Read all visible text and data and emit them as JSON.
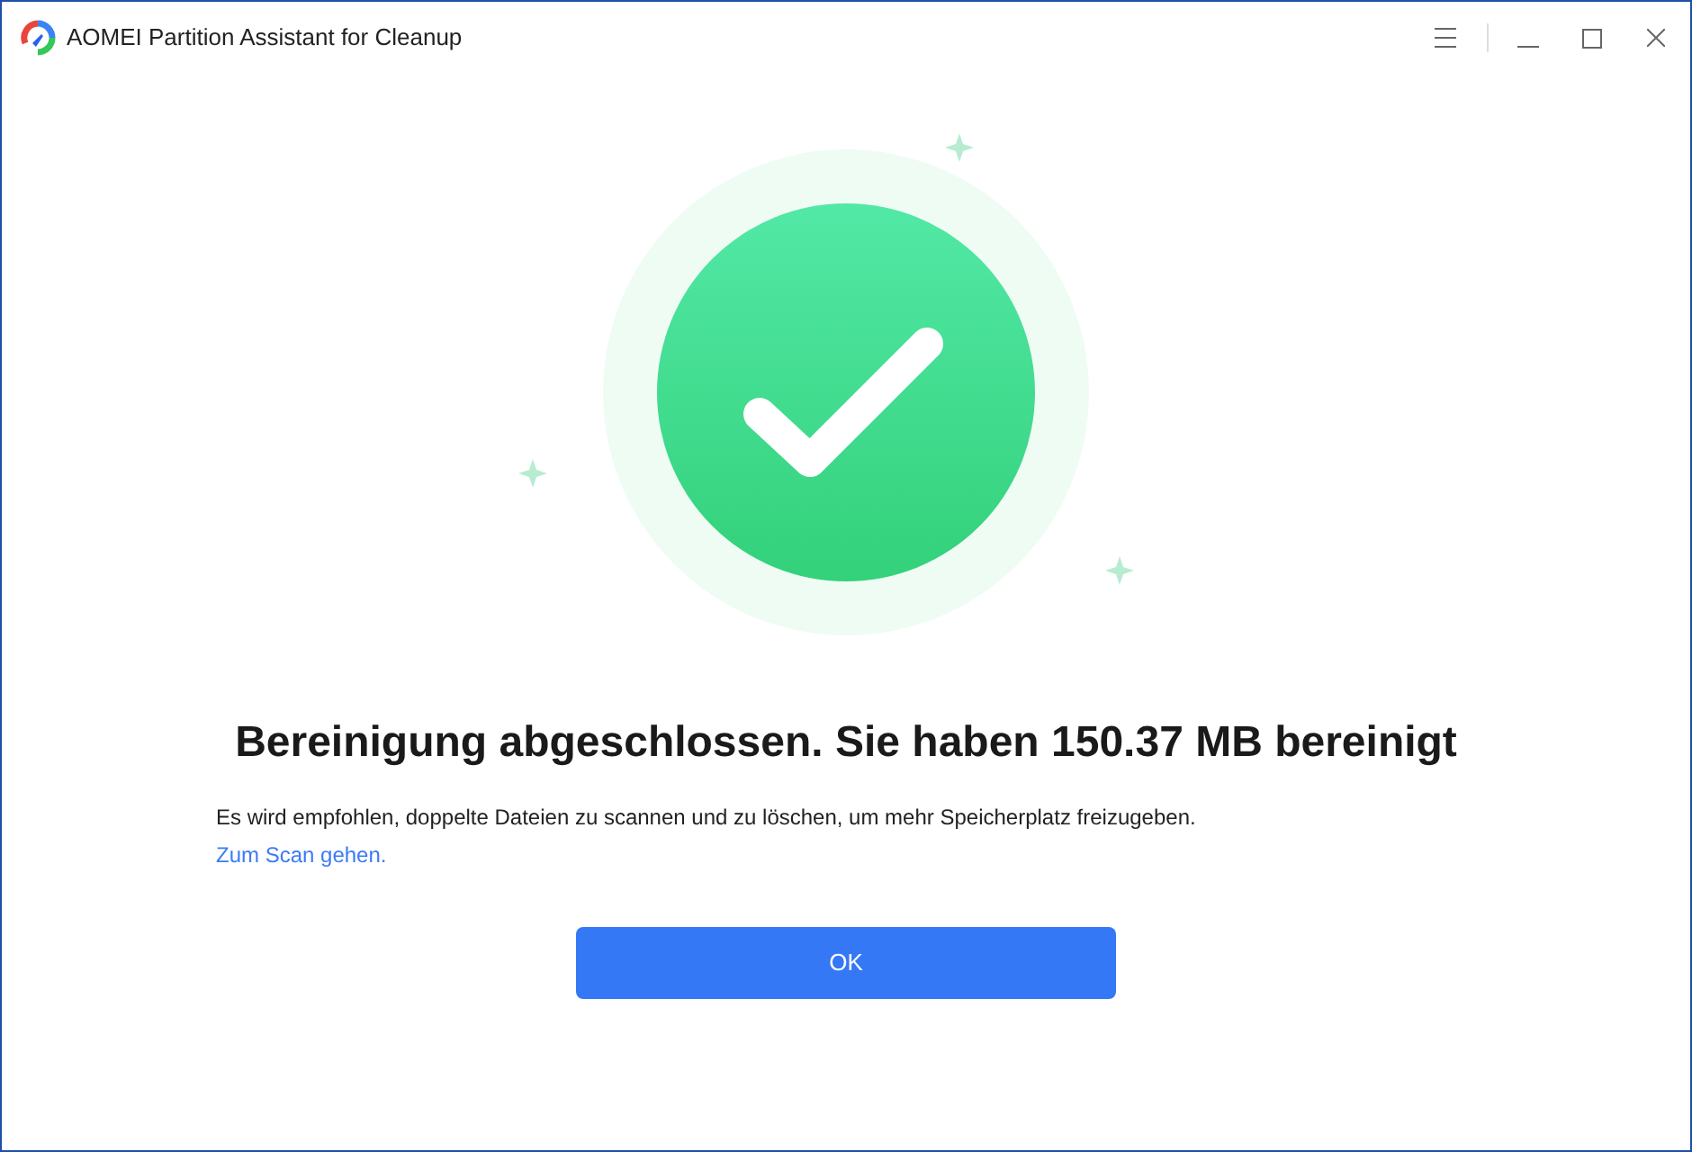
{
  "window": {
    "title": "AOMEI Partition Assistant for Cleanup"
  },
  "result": {
    "heading": "Bereinigung abgeschlossen. Sie haben 150.37 MB bereinigt",
    "message": "Es wird empfohlen, doppelte Dateien zu scannen und zu löschen, um mehr Speicherplatz freizugeben.",
    "link": "Zum Scan gehen."
  },
  "buttons": [
    "OK"
  ]
}
